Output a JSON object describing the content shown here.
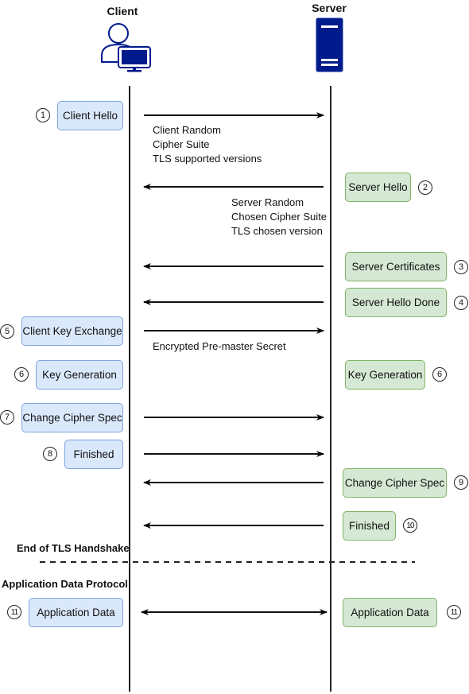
{
  "actors": {
    "client": {
      "label": "Client",
      "icon": "user-computer-icon"
    },
    "server": {
      "label": "Server",
      "icon": "server-icon"
    }
  },
  "colors": {
    "client_fill": "#dae8fc",
    "client_border": "#7ea6e0",
    "server_fill": "#d5e8d4",
    "server_border": "#82b366",
    "icon_blue": "#001a8c",
    "line": "#222222"
  },
  "steps": [
    {
      "num": "1",
      "side": "client",
      "label": "Client Hello",
      "direction": "to-server",
      "notes": [
        "Client Random",
        "Cipher Suite",
        "TLS supported versions"
      ]
    },
    {
      "num": "2",
      "side": "server",
      "label": "Server Hello",
      "direction": "to-client",
      "notes": [
        "Server Random",
        "Chosen Cipher Suite",
        "TLS chosen version"
      ]
    },
    {
      "num": "3",
      "side": "server",
      "label": "Server Certificates",
      "direction": "to-client"
    },
    {
      "num": "4",
      "side": "server",
      "label": "Server Hello Done",
      "direction": "to-client"
    },
    {
      "num": "5",
      "side": "client",
      "label": "Client Key Exchange",
      "direction": "to-server",
      "notes": [
        "Encrypted Pre-master Secret"
      ]
    },
    {
      "num": "6",
      "side": "client",
      "label": "Key Generation"
    },
    {
      "num": "6",
      "side": "server",
      "label": "Key Generation"
    },
    {
      "num": "7",
      "side": "client",
      "label": "Change Cipher Spec",
      "direction": "to-server"
    },
    {
      "num": "8",
      "side": "client",
      "label": "Finished",
      "direction": "to-server"
    },
    {
      "num": "9",
      "side": "server",
      "label": "Change Cipher Spec",
      "direction": "to-client"
    },
    {
      "num": "10",
      "side": "server",
      "label": "Finished",
      "direction": "to-client"
    },
    {
      "num": "11",
      "side": "client",
      "label": "Application Data",
      "direction": "both"
    },
    {
      "num": "11",
      "side": "server",
      "label": "Application Data"
    }
  ],
  "sections": {
    "end_handshake": "End of TLS Handshake",
    "app_data_protocol": "Application Data Protocol"
  }
}
